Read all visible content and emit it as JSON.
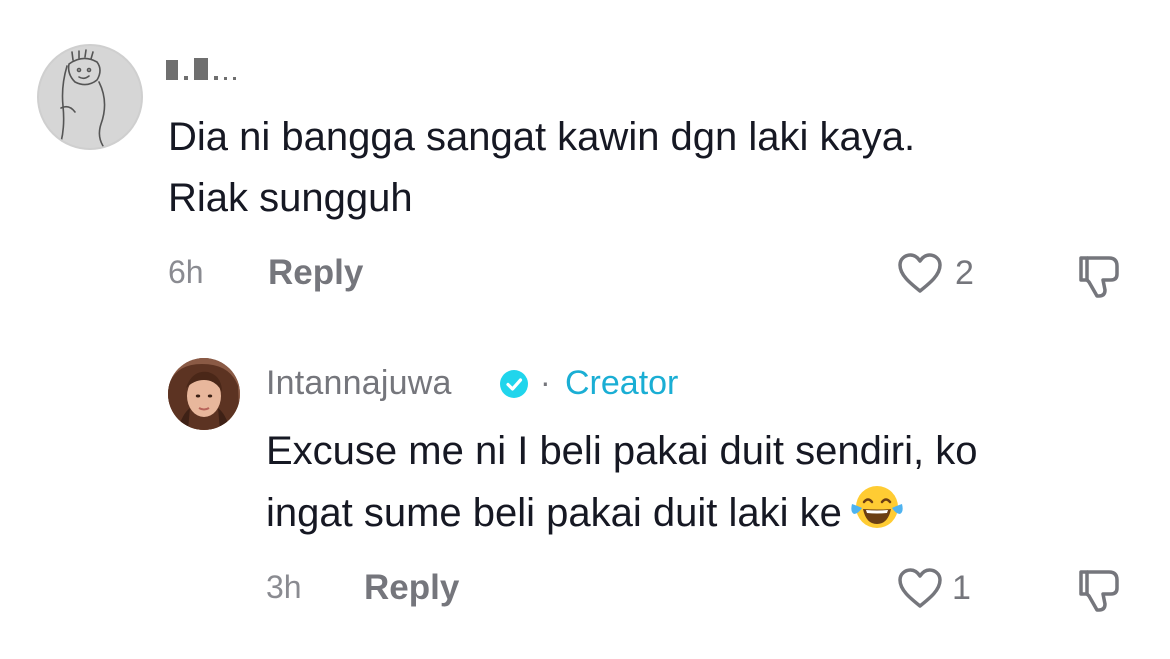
{
  "comments": [
    {
      "username_redacted": true,
      "avatar": "hand-drawn-sketch-avatar",
      "text_lines": [
        "Dia ni bangga sangat kawin dgn laki kaya.",
        "Riak sungguh"
      ],
      "time": "6h",
      "reply_label": "Reply",
      "like_count": "2",
      "like_icon": "heart-outline-icon",
      "dislike_icon": "thumbs-down-icon"
    },
    {
      "username": "Intannajuwa",
      "verified_icon": "verified-check-icon",
      "separator": "·",
      "creator_label": "Creator",
      "avatar": "photo-avatar",
      "text_lines": [
        "Excuse me ni I beli pakai duit sendiri, ko",
        "ingat sume beli pakai duit laki ke"
      ],
      "emoji": "face-with-tears-of-joy-emoji",
      "time": "3h",
      "reply_label": "Reply",
      "like_count": "1",
      "like_icon": "heart-outline-icon",
      "dislike_icon": "thumbs-down-icon"
    }
  ],
  "colors": {
    "text": "#161823",
    "secondary": "#75767c",
    "creator": "#1aaed4",
    "verified": "#20d5ec"
  }
}
